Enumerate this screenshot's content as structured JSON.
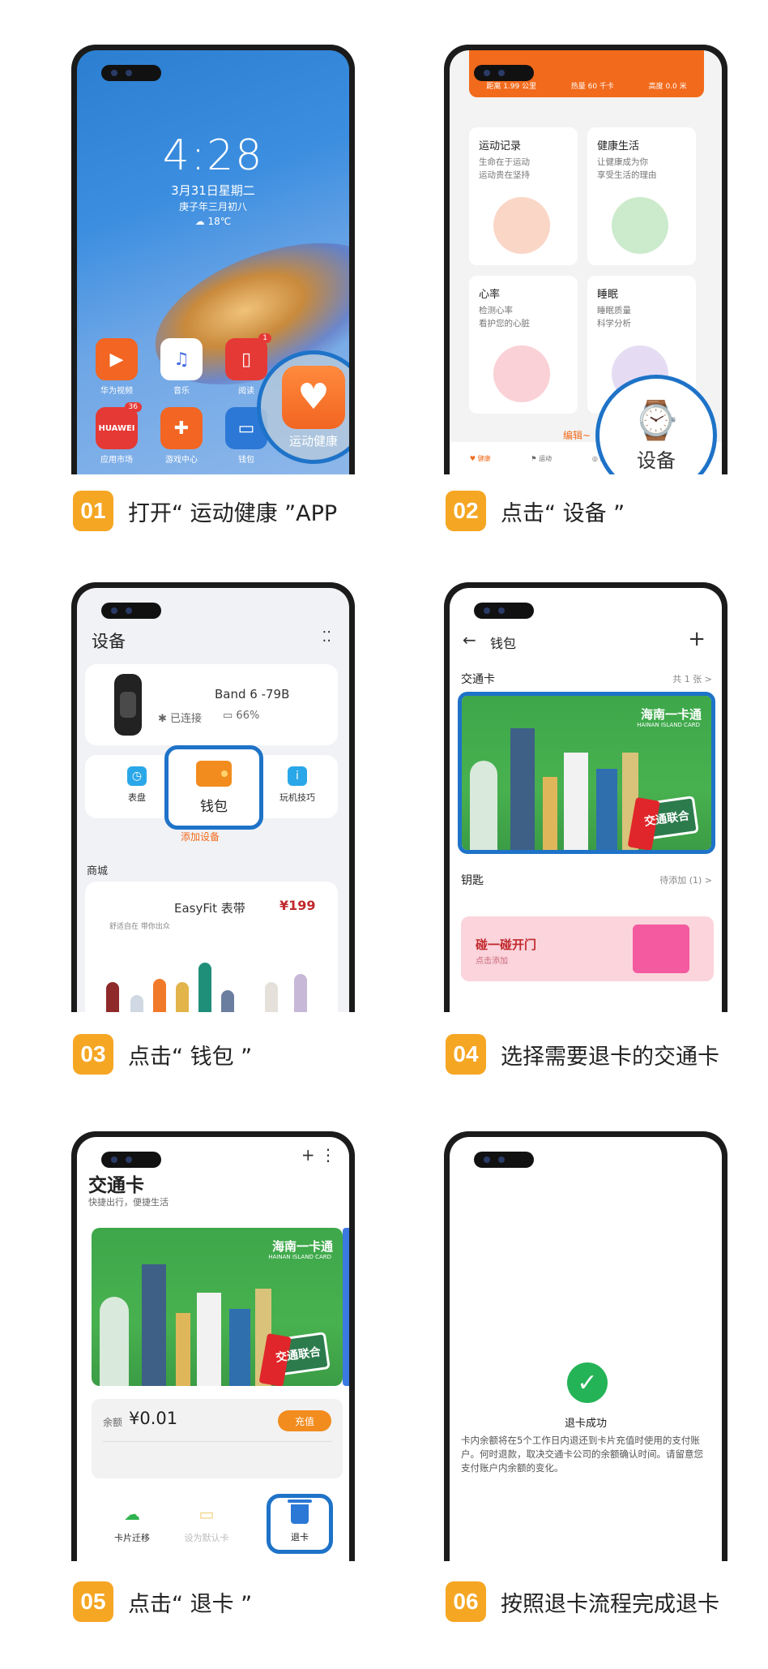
{
  "steps": [
    {
      "num": "01",
      "text": "打开“ 运动健康 ”APP"
    },
    {
      "num": "02",
      "text": "点击“ 设备 ”"
    },
    {
      "num": "03",
      "text": "点击“ 钱包 ”"
    },
    {
      "num": "04",
      "text": "选择需要退卡的交通卡"
    },
    {
      "num": "05",
      "text": "点击“ 退卡 ”"
    },
    {
      "num": "06",
      "text": "按照退卡流程完成退卡"
    }
  ],
  "screen1": {
    "time": "4:28",
    "date": "3月31日星期二",
    "lunar": "庚子年三月初八",
    "weather": "☁ 18℃",
    "apps": [
      {
        "label": "华为视频",
        "icon": "play-icon",
        "color": "#f26522",
        "badge": ""
      },
      {
        "label": "音乐",
        "icon": "music-icon",
        "color": "#ffffff",
        "badge": ""
      },
      {
        "label": "阅读",
        "icon": "book-icon",
        "color": "#e53935",
        "badge": "1"
      },
      {
        "label": "应用市场",
        "icon": "huawei-icon",
        "color": "#e53935",
        "badge": "36"
      },
      {
        "label": "游戏中心",
        "icon": "gamepad-icon",
        "color": "#f26522",
        "badge": ""
      },
      {
        "label": "钱包",
        "icon": "wallet-icon",
        "color": "#2b78d6",
        "badge": ""
      }
    ],
    "highlight_label": "运动健康"
  },
  "screen2": {
    "stats": [
      "距离 1.99 公里",
      "热量 60 千卡",
      "高度 0.0 米"
    ],
    "tiles": [
      {
        "title": "运动记录",
        "lines": [
          "生命在于运动",
          "运动贵在坚持"
        ]
      },
      {
        "title": "健康生活",
        "lines": [
          "让健康成为你",
          "享受生活的理由"
        ]
      },
      {
        "title": "心率",
        "lines": [
          "检测心率",
          "看护您的心脏"
        ]
      },
      {
        "title": "睡眠",
        "lines": [
          "睡眠质量",
          "科学分析"
        ]
      }
    ],
    "edit": "编辑~",
    "tabs": [
      "健康",
      "运动",
      "发现"
    ],
    "highlight_label": "设备"
  },
  "screen3": {
    "title": "设备",
    "device_name": "Band 6 -79B",
    "status": "已连接",
    "battery": "66%",
    "functions": [
      "表盘",
      "钱包",
      "玩机技巧"
    ],
    "add_device": "添加设备",
    "mall": "商城",
    "product": "EasyFit 表带",
    "price": "¥199",
    "product_sub": "舒适自在 带你出众"
  },
  "screen4": {
    "title": "钱包",
    "transit_label": "交通卡",
    "transit_count": "共 1 张 >",
    "card_logo": "海南一卡通",
    "card_logo_sub": "HAINAN ISLAND CARD",
    "union": "交通联合",
    "key_label": "钥匙",
    "key_count": "待添加 (1) >",
    "key_title": "碰一碰开门",
    "key_sub": "点击添加"
  },
  "screen5": {
    "title": "交通卡",
    "subtitle": "快捷出行，便捷生活",
    "balance_label": "余额",
    "balance": "¥0.01",
    "recharge": "充值",
    "actions": [
      "卡片迁移",
      "设为默认卡",
      "退卡"
    ]
  },
  "screen6": {
    "title": "退卡成功",
    "text": "卡内余额将在5个工作日内退还到卡片充值时使用的支付账户。何时退款，取决交通卡公司的余额确认时间。请留意您支付账户内余额的变化。"
  }
}
